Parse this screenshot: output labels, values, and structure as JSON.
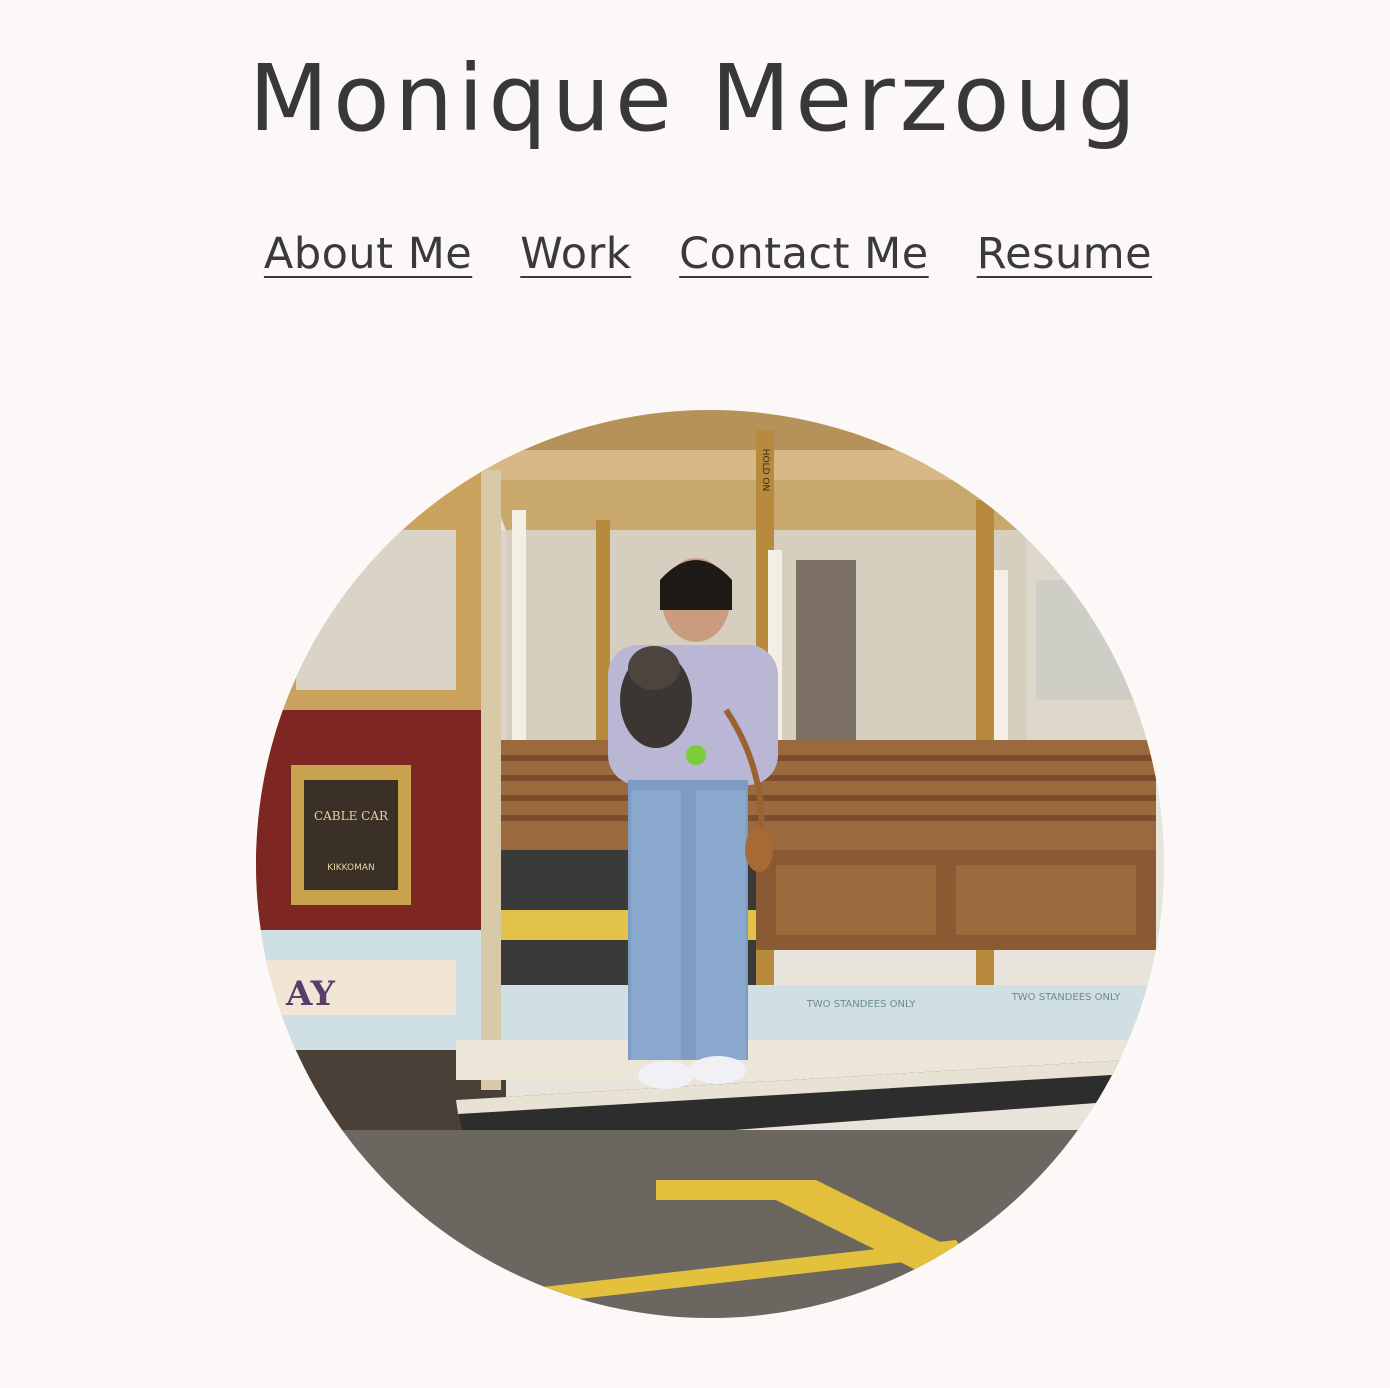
{
  "header": {
    "title": "Monique Merzoug"
  },
  "nav": {
    "items": [
      {
        "label": "About Me"
      },
      {
        "label": "Work"
      },
      {
        "label": "Contact Me"
      },
      {
        "label": "Resume"
      }
    ]
  },
  "profile_photo": {
    "description": "circular-portrait",
    "sign_text": "CABLE CAR",
    "sponsor_text": "KIKKOMAN",
    "panel_text": "AY",
    "standees_text": "TWO STANDEES ONLY",
    "pole_text": "HOLD ON"
  },
  "colors": {
    "background": "#fbf8f7",
    "text": "#383838"
  }
}
